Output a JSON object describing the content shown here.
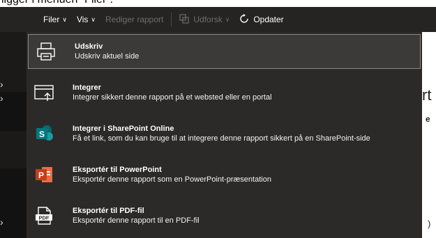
{
  "caption": {
    "text": "ligger i menuen “Filer”."
  },
  "toolbar": {
    "file_label": "Filer",
    "view_label": "Vis",
    "edit_report_label": "Rediger rapport",
    "explore_label": "Udforsk",
    "refresh_label": "Opdater",
    "chevron": "∨",
    "refresh_icon": "refresh-icon",
    "explore_icon": "explore-icon"
  },
  "menu": {
    "items": [
      {
        "title": "Udskriv",
        "description": "Udskriv aktuel side",
        "icon": "printer-icon"
      },
      {
        "title": "Integrer",
        "description": "Integrer sikkert denne rapport på et websted eller en portal",
        "icon": "embed-icon"
      },
      {
        "title": "Integrer i SharePoint Online",
        "description": "Få et link, som du kan bruge til at integrere denne rapport sikkert på en SharePoint-side",
        "icon": "sharepoint-icon"
      },
      {
        "title": "Eksportér til PowerPoint",
        "description": "Eksportér denne rapport som en PowerPoint-præsentation",
        "icon": "powerpoint-icon"
      },
      {
        "title": "Eksportér til PDF-fil",
        "description": "Eksportér denne rapport til en PDF-fil",
        "icon": "pdf-icon"
      }
    ]
  },
  "report_fragments": {
    "frag1": "rt",
    "frag2": "e",
    "frag3": ")"
  },
  "colors": {
    "toolbar_bg": "#252423",
    "menu_bg": "#2b2a29",
    "highlight_bg": "#3b3a39",
    "sharepoint": "#036c70",
    "powerpoint": "#c43e1c"
  }
}
